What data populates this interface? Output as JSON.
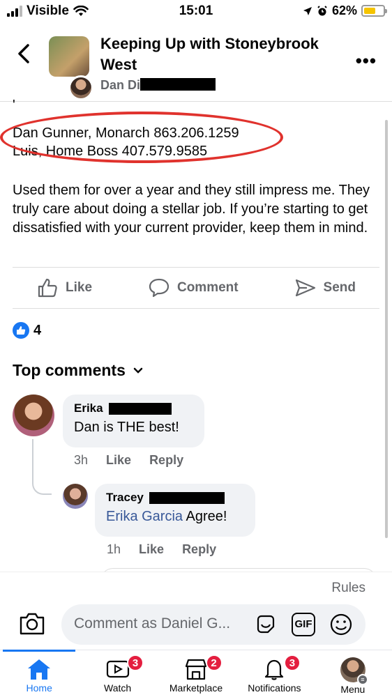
{
  "status_bar": {
    "carrier": "Visible",
    "time": "15:01",
    "battery": "62%",
    "battery_level": 0.62,
    "icons": [
      "signal-icon",
      "wifi-icon",
      "location-icon",
      "alarm-icon",
      "battery-icon"
    ]
  },
  "header": {
    "title": "Keeping Up with Stoneybrook West",
    "subtitle": "Dan Di",
    "icons": [
      "back-icon",
      "more-icon"
    ]
  },
  "post": {
    "cut_line": "'",
    "contact_highlighted": "Dan Gunner, Monarch 863.206.1259",
    "contact_partial": "Luis, Home Boss 407.579.9585",
    "body": "Used them for over a year and they still impress me. They truly care about doing a stellar job. If you’re starting to get dissatisfied with your current provider, keep them in mind.",
    "highlight_color": "#e0322d"
  },
  "actions": {
    "like": "Like",
    "comment": "Comment",
    "send": "Send"
  },
  "reactions": {
    "count": "4"
  },
  "comments_header": {
    "label": "Top comments"
  },
  "comments": [
    {
      "name": "Erika",
      "text": "Dan is THE best!",
      "time": "3h",
      "like": "Like",
      "reply": "Reply"
    },
    {
      "name": "Tracey",
      "mention": "Erika Garcia",
      "text": " Agree!",
      "time": "1h",
      "like": "Like",
      "reply": "Reply"
    }
  ],
  "composer": {
    "rules": "Rules",
    "placeholder": "Comment as Daniel G...",
    "gif": "GIF"
  },
  "nav": {
    "home": "Home",
    "watch": "Watch",
    "watch_badge": "3",
    "marketplace": "Marketplace",
    "marketplace_badge": "2",
    "notifications": "Notifications",
    "notifications_badge": "3",
    "menu": "Menu",
    "active_color": "#1877f2"
  }
}
